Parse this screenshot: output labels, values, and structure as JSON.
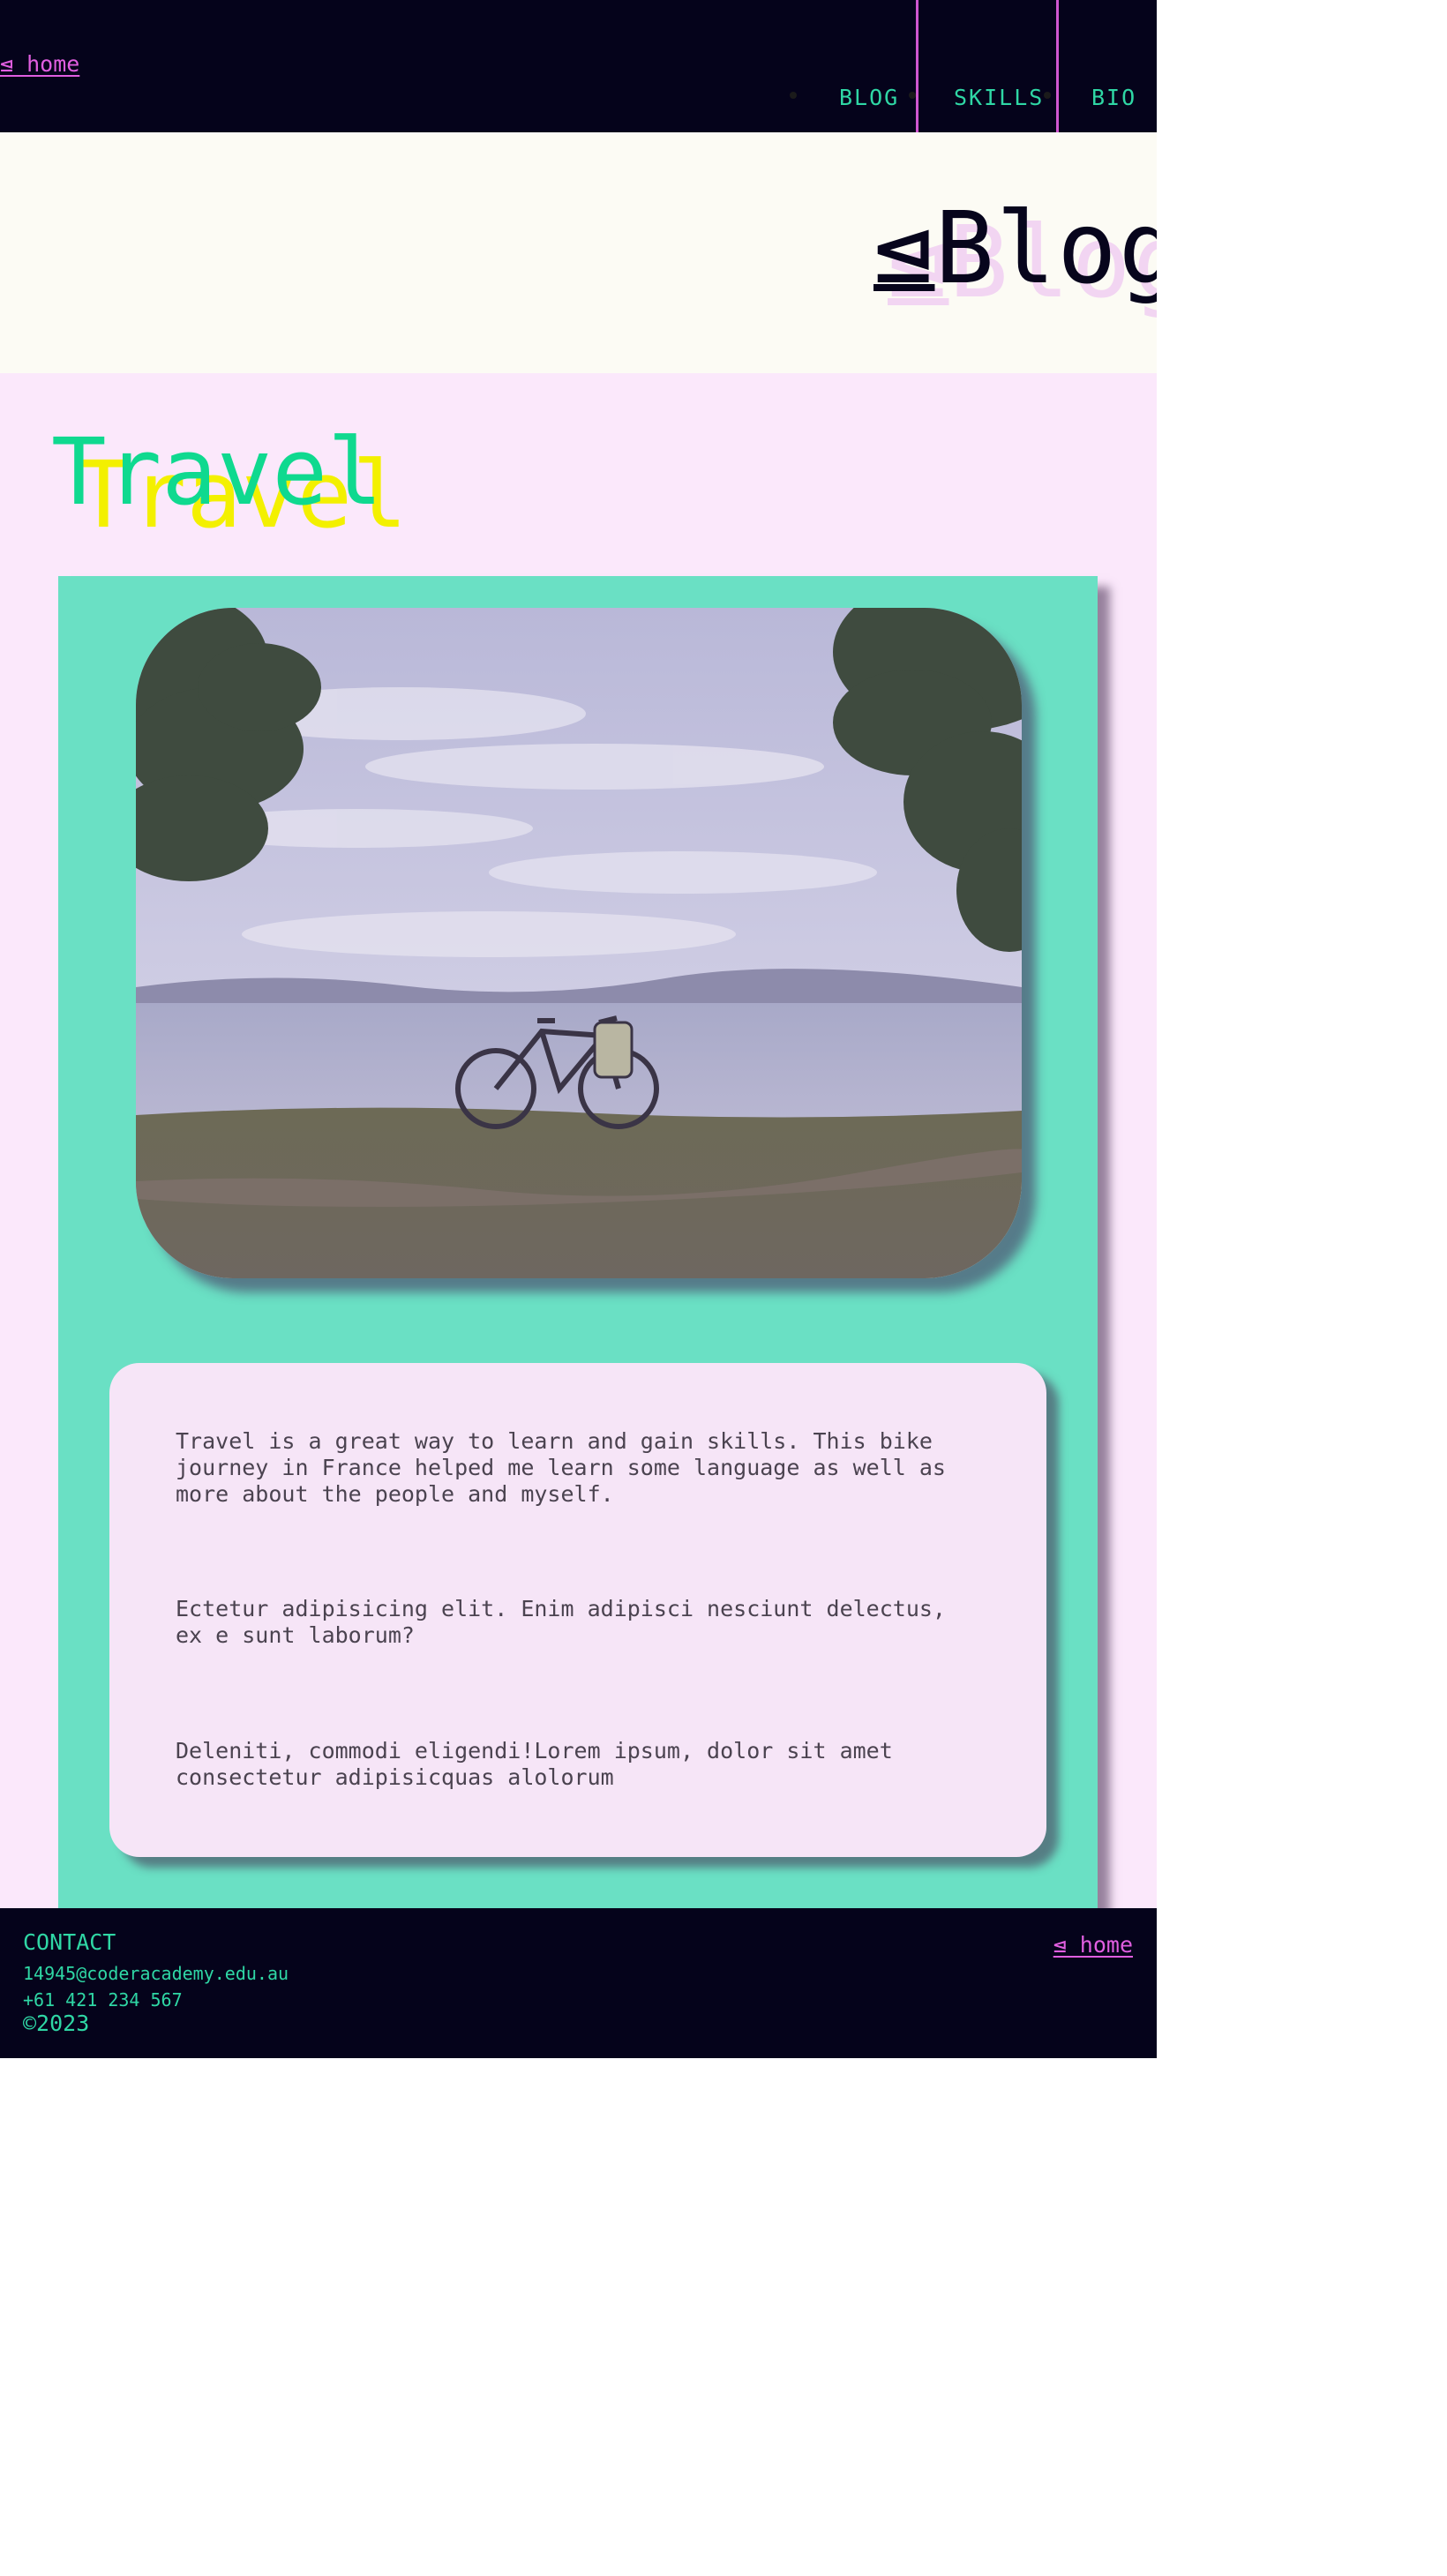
{
  "header": {
    "home_link": "⊴ home",
    "nav": [
      {
        "label": "BLOG"
      },
      {
        "label": "SKILLS"
      },
      {
        "label": "BIO"
      }
    ]
  },
  "hero": {
    "title_symbol": "⊴",
    "title": "Blog"
  },
  "section": {
    "title": "Travel"
  },
  "article": {
    "paragraphs": [
      "Travel is a great way to learn and gain skills. This bike\njourney in France helped me learn some language as well as\nmore about the people and myself.",
      "Ectetur adipisicing elit. Enim adipisci nesciunt delectus,\nex e sunt laborum?",
      "Deleniti, commodi eligendi!Lorem ipsum, dolor sit amet\nconsectetur adipisicquas alolorum"
    ]
  },
  "footer": {
    "contact_heading": "CONTACT",
    "email": "14945@coderacademy.edu.au",
    "phone": "+61 421 234 567",
    "copyright": "©2023",
    "home_link": "⊴ home"
  },
  "colors": {
    "header_bg": "#05031b",
    "accent_green": "#2fd7a5",
    "accent_pink": "#e05ee0",
    "hero_bg": "#fcfbf4",
    "main_bg": "#fbe8fb",
    "card_bg": "#6ae0c4",
    "title_green": "#0fd98f",
    "title_yellow": "#f3f000"
  }
}
